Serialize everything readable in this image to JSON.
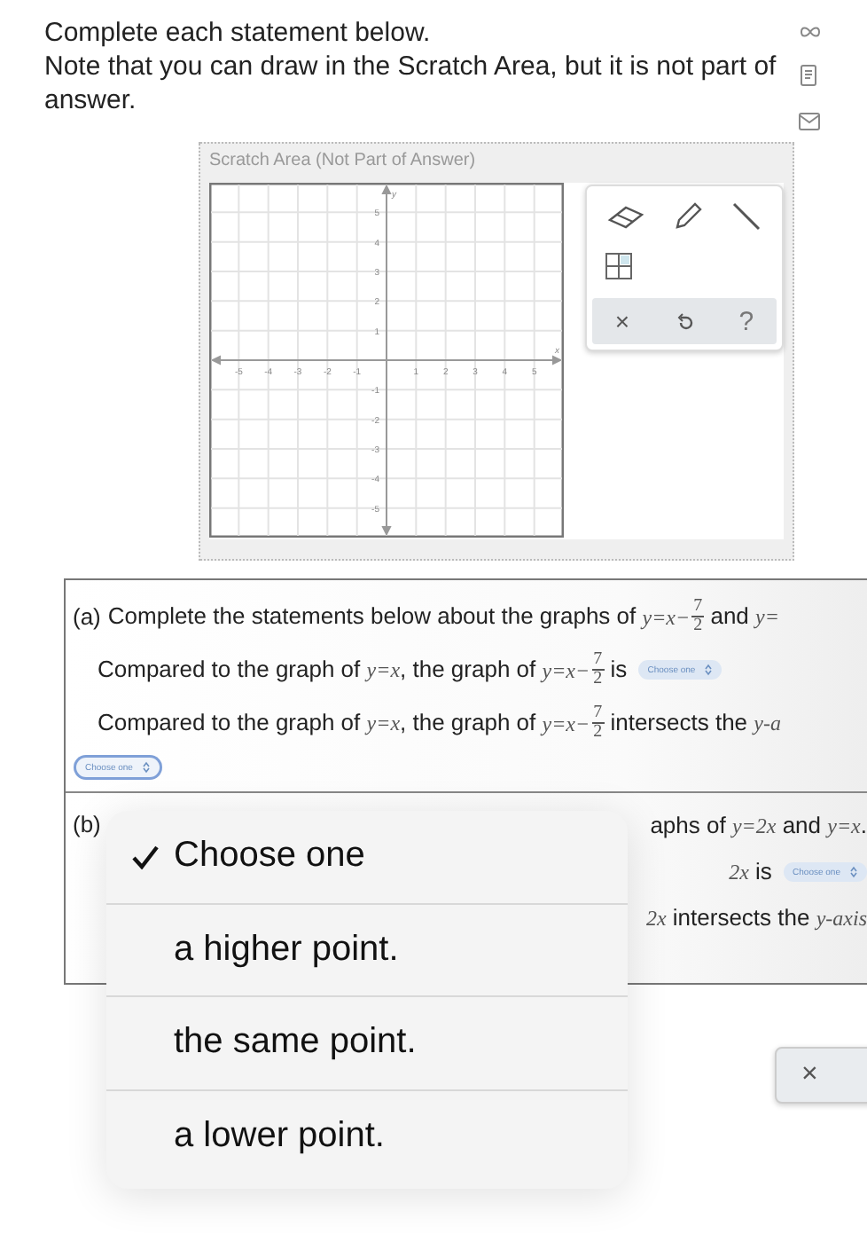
{
  "instructions": [
    "Complete each statement below.",
    "Note that you can draw in the Scratch Area, but it is not part of",
    "answer."
  ],
  "scratch": {
    "title": "Scratch Area (Not Part of Answer)",
    "graph": {
      "x_label": "x",
      "y_label": "y",
      "x_ticks": [
        "-5",
        "-4",
        "-3",
        "-2",
        "-1",
        "1",
        "2",
        "3",
        "4",
        "5"
      ],
      "y_ticks": [
        "5",
        "4",
        "3",
        "2",
        "1",
        "-1",
        "-2",
        "-3",
        "-4",
        "-5"
      ]
    },
    "actions": [
      {
        "kind": "clear",
        "text": "×"
      },
      {
        "kind": "undo"
      },
      {
        "kind": "help",
        "text": "?"
      }
    ]
  },
  "part_a": {
    "label": "(a)",
    "lines": [
      [
        {
          "kind": "text",
          "text": "Complete the statements below about the graphs of "
        },
        {
          "kind": "frac",
          "pre": "y=x−",
          "num": "7",
          "den": "2"
        },
        {
          "kind": "text",
          "text": " and "
        },
        {
          "kind": "math",
          "text": "y="
        }
      ],
      [
        {
          "kind": "text",
          "text": "Compared to the graph of "
        },
        {
          "kind": "math",
          "text": "y=x"
        },
        {
          "kind": "text",
          "text": ", the graph of "
        },
        {
          "kind": "frac",
          "pre": "y=x−",
          "num": "7",
          "den": "2"
        },
        {
          "kind": "text",
          "text": " is "
        },
        {
          "kind": "select",
          "text": "Choose one",
          "focused": false
        }
      ],
      [
        {
          "kind": "text",
          "text": "Compared to the graph of "
        },
        {
          "kind": "math",
          "text": "y=x"
        },
        {
          "kind": "text",
          "text": ", the graph of "
        },
        {
          "kind": "frac",
          "pre": "y=x−",
          "num": "7",
          "den": "2"
        },
        {
          "kind": "text",
          "text": " intersects the "
        },
        {
          "kind": "math",
          "text": "y-a"
        }
      ],
      [
        {
          "kind": "select",
          "text": "Choose one",
          "focused": true
        }
      ]
    ]
  },
  "part_b": {
    "label": "(b)",
    "lines": [
      [
        {
          "kind": "text",
          "text": "aphs of "
        },
        {
          "kind": "math",
          "text": "y=2x"
        },
        {
          "kind": "text",
          "text": " and "
        },
        {
          "kind": "math",
          "text": "y=x"
        },
        {
          "kind": "text",
          "text": "."
        }
      ],
      [
        {
          "kind": "math",
          "text": "2x"
        },
        {
          "kind": "text",
          "text": " is "
        },
        {
          "kind": "select",
          "text": "Choose one",
          "focused": false
        }
      ],
      [
        {
          "kind": "math",
          "text": "2x"
        },
        {
          "kind": "text",
          "text": " intersects the "
        },
        {
          "kind": "math",
          "text": "y-axis"
        }
      ]
    ]
  },
  "dropdown": {
    "options": [
      {
        "text": "Choose one",
        "selected": true
      },
      {
        "text": "a higher point.",
        "selected": false
      },
      {
        "text": "the same point.",
        "selected": false
      },
      {
        "text": "a lower point.",
        "selected": false
      }
    ]
  },
  "clear_button": {
    "text": "×"
  }
}
